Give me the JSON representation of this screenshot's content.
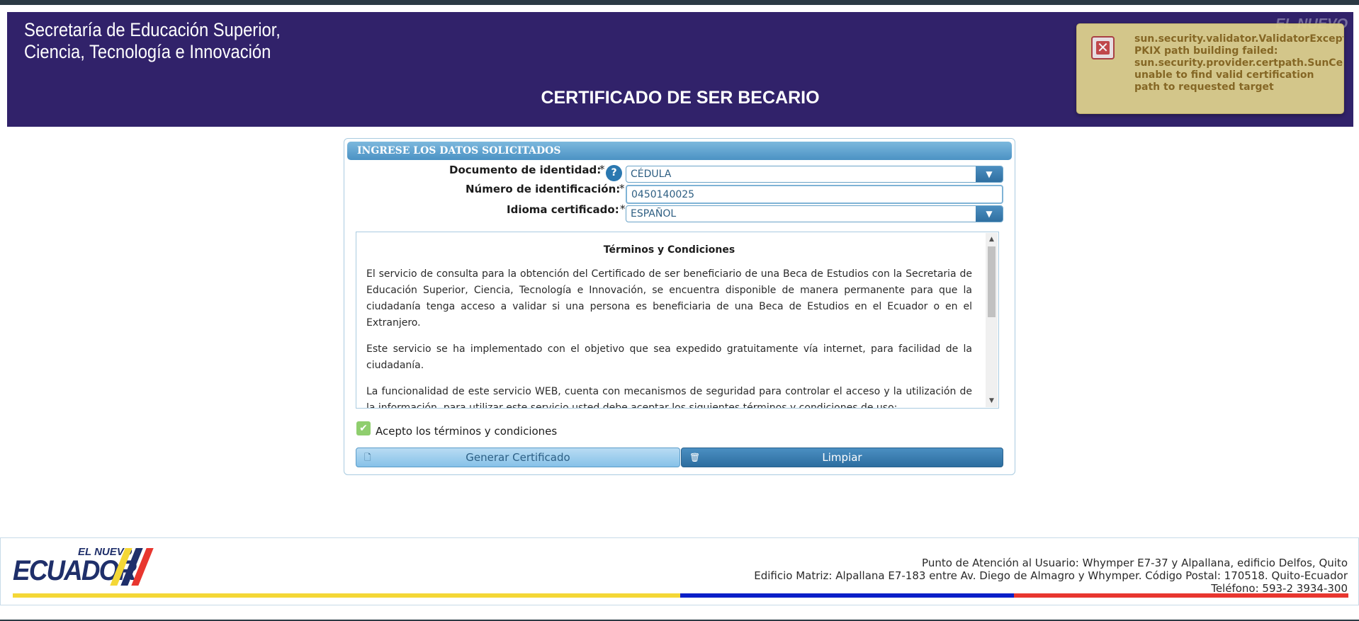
{
  "header": {
    "org_line1": "Secretaría de Educación Superior,",
    "org_line2": "Ciencia, Tecnología e Innovación",
    "page_title": "CERTIFICADO DE SER BECARIO",
    "watermark": "EL NUEVO"
  },
  "toast": {
    "message": "sun.security.validator.ValidatorException:\nPKIX path building failed:\nsun.security.provider.certpath.SunCertPathBuilderException:\nunable to find valid certification\npath to requested target",
    "icon": "error-close-icon"
  },
  "form": {
    "panel_title": "INGRESE LOS DATOS SOLICITADOS",
    "doc_label": "Documento de identidad:",
    "doc_value": "CÉDULA",
    "id_label": "Número de identificación:",
    "id_value": "0450140025",
    "lang_label": "Idioma certificado:",
    "lang_value": "ESPAÑOL",
    "required_mark": "*",
    "help_icon": "?"
  },
  "terms": {
    "title": "Términos y Condiciones",
    "paragraphs": [
      "El servicio de consulta para la obtención del Certificado de ser beneficiario de una Beca de Estudios con la Secretaria de Educación Superior, Ciencia, Tecnología e Innovación, se encuentra disponible de manera permanente para que la ciudadanía tenga acceso a validar si una persona es beneficiaria de una Beca de Estudios en el Ecuador o en el Extranjero.",
      "Este servicio se ha implementado con el objetivo que sea expedido gratuitamente vía internet, para facilidad de la ciudadanía.",
      "La funcionalidad de este servicio WEB, cuenta con mecanismos de seguridad para controlar el acceso y la utilización de la información, para utilizar este servicio usted debe aceptar los siguientes términos y condiciones de uso:"
    ]
  },
  "accept": {
    "label": "Acepto los términos y condiciones",
    "checked": true
  },
  "buttons": {
    "generate": "Generar Certificado",
    "clear": "Limpiar"
  },
  "footer": {
    "logo_small": "EL NUEVO",
    "logo_big": "ECUADOR",
    "line1": "Punto de Atención al Usuario: Whymper E7-37 y Alpallana, edificio Delfos, Quito",
    "line2": "Edificio Matriz: Alpallana E7-183 entre Av. Diego de Almagro y Whymper. Código Postal: 170518. Quito-Ecuador",
    "line3": "Teléfono: 593-2 3934-300"
  },
  "colors": {
    "header_bg": "#31226a",
    "accent_blue": "#2d6d9e",
    "toast_bg": "#dccf8c",
    "flag_yellow": "#f4d736",
    "flag_blue": "#0b1fc8",
    "flag_red": "#e8362f"
  }
}
